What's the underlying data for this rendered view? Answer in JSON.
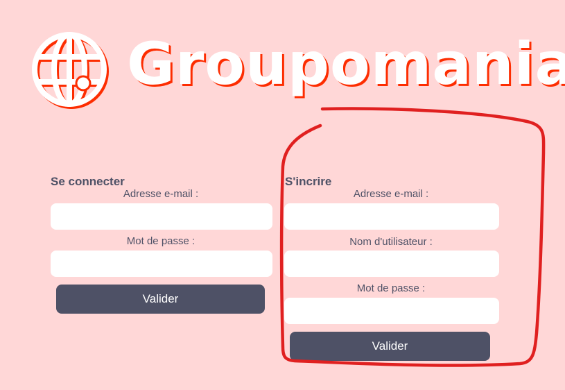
{
  "brand": {
    "name": "Groupomania",
    "accent_color": "#FD2D01",
    "text_color": "#4E5166",
    "background_color": "#FFD7D7"
  },
  "login": {
    "title": "Se connecter",
    "email_label": "Adresse e-mail :",
    "email_value": "",
    "password_label": "Mot de passe :",
    "password_value": "",
    "submit_label": "Valider"
  },
  "signup": {
    "title": "S'incrire",
    "email_label": "Adresse e-mail :",
    "email_value": "",
    "username_label": "Nom d'utilisateur :",
    "username_value": "",
    "password_label": "Mot de passe :",
    "password_value": "",
    "submit_label": "Valider"
  },
  "annotation": {
    "color": "#E02020"
  }
}
